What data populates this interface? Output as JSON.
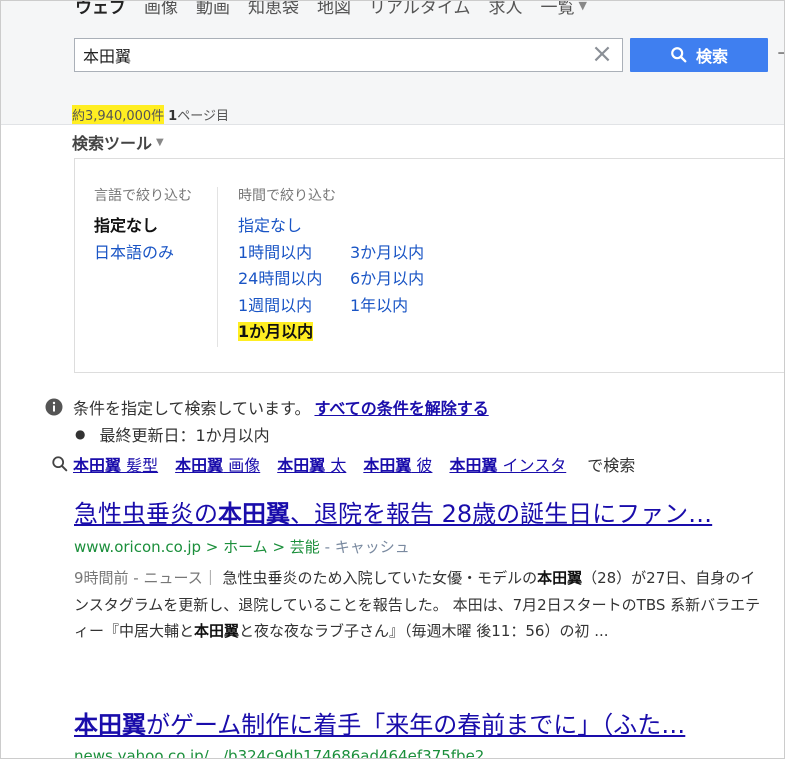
{
  "nav": {
    "items": [
      "ウェブ",
      "画像",
      "動画",
      "知恵袋",
      "地図",
      "リアルタイム",
      "求人"
    ],
    "more": "一覧"
  },
  "search": {
    "query": "本田翼",
    "clear": "×",
    "button": "検索"
  },
  "results_info": {
    "count": "約3,940,000件",
    "page_num": "1",
    "page_label": "ページ目"
  },
  "tools": {
    "label": "検索ツール",
    "lang_heading": "言語で絞り込む",
    "lang_options": [
      "指定なし",
      "日本語のみ"
    ],
    "time_heading": "時間で絞り込む",
    "time_options": {
      "none": "指定なし",
      "h1": "1時間以内",
      "h24": "24時間以内",
      "w1": "1週間以内",
      "m1": "1か月以内",
      "m3": "3か月以内",
      "m6": "6か月以内",
      "y1": "1年以内"
    }
  },
  "conditions": {
    "text": "条件を指定して検索しています。",
    "clear_link": "すべての条件を解除する",
    "item": "最終更新日：1か月以内"
  },
  "related": {
    "items": [
      {
        "bold": "本田翼",
        "rest": " 髪型"
      },
      {
        "bold": "本田翼",
        "rest": " 画像"
      },
      {
        "bold": "本田翼",
        "rest": " 太"
      },
      {
        "bold": "本田翼",
        "rest": " 彼"
      },
      {
        "bold": "本田翼",
        "rest": " インスタ"
      }
    ],
    "suffix": "で検索"
  },
  "results": [
    {
      "title_pre": "急性虫垂炎の",
      "title_bold": "本田翼",
      "title_post": "、退院を報告 28歳の誕生日にファン…",
      "url": "www.oricon.co.jp > ホーム > 芸能",
      "cache": " - キャッシュ",
      "meta": "9時間前 - ニュース｜ ",
      "desc_1": "急性虫垂炎のため入院していた女優・モデルの",
      "desc_bold_1": "本田翼",
      "desc_2": "（28）が27日、自身のインスタグラムを更新し、退院していることを報告した。 本田は、7月2日スタートのTBS 系新バラエティー『中居大輔と",
      "desc_bold_2": "本田翼",
      "desc_3": "と夜な夜なラブ子さん』（毎週木曜 後11：56）の初 ..."
    },
    {
      "title_bold": "本田翼",
      "title_post": "がゲーム制作に着手「来年の春前までに」（ふた…",
      "url": "news.yahoo.co.jp/.../b324c9db174686ad464ef375fbe2"
    }
  ],
  "colors": {
    "highlight": "#ffee22",
    "link": "#1a0dab",
    "url": "#1b8f3b",
    "search_button": "#3f7ff0"
  }
}
